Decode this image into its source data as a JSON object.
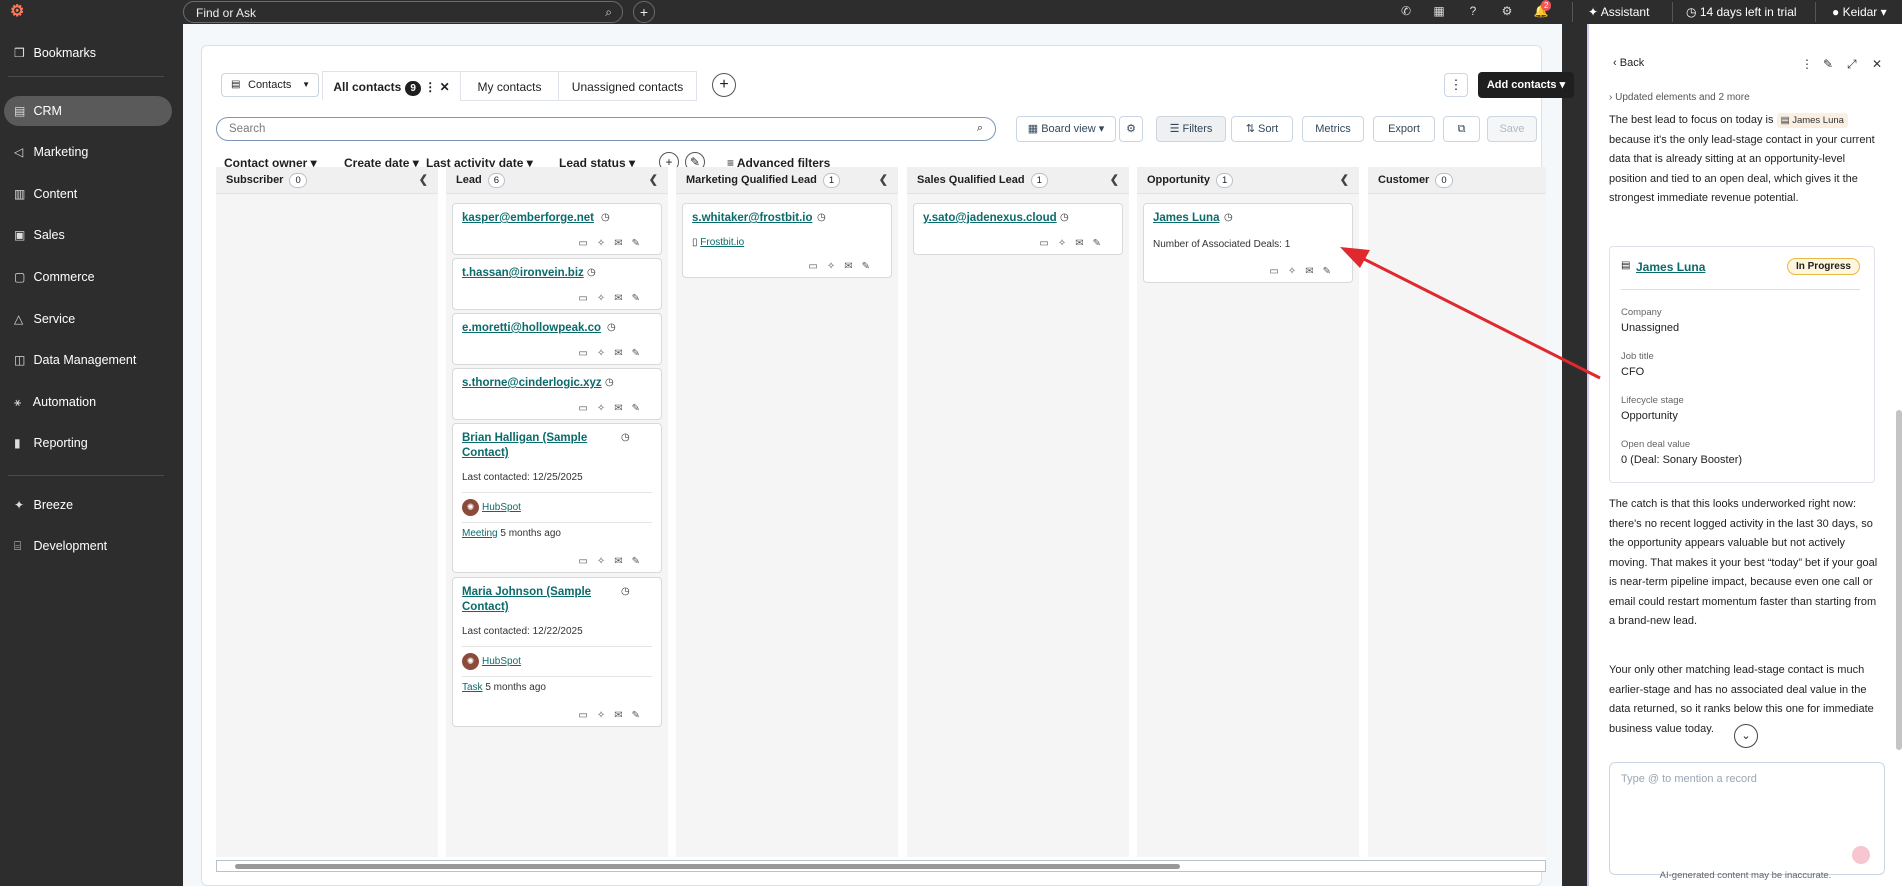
{
  "topbar": {
    "search_placeholder": "Find or Ask",
    "assistant_label": "Assistant",
    "trial_label": "14 days left in trial",
    "user_name": "Keidar",
    "notification_count": "2"
  },
  "sidebar": {
    "items": [
      {
        "label": "Bookmarks",
        "icon": "bookmark-icon"
      },
      {
        "label": "CRM",
        "icon": "crm-icon"
      },
      {
        "label": "Marketing",
        "icon": "megaphone-icon"
      },
      {
        "label": "Content",
        "icon": "content-icon"
      },
      {
        "label": "Sales",
        "icon": "sales-icon"
      },
      {
        "label": "Commerce",
        "icon": "commerce-icon"
      },
      {
        "label": "Service",
        "icon": "service-icon"
      },
      {
        "label": "Data Management",
        "icon": "database-icon"
      },
      {
        "label": "Automation",
        "icon": "automation-icon"
      },
      {
        "label": "Reporting",
        "icon": "chart-icon"
      },
      {
        "label": "Breeze",
        "icon": "sparkle-icon"
      },
      {
        "label": "Development",
        "icon": "code-icon"
      }
    ]
  },
  "header": {
    "object_selector": "Contacts",
    "tabs": [
      {
        "label": "All contacts",
        "count": "9"
      },
      {
        "label": "My contacts"
      },
      {
        "label": "Unassigned contacts"
      }
    ],
    "add_contacts_label": "Add contacts"
  },
  "toolbar": {
    "search_placeholder": "Search",
    "view_label": "Board view",
    "filters_label": "Filters",
    "sort_label": "Sort",
    "metrics_label": "Metrics",
    "export_label": "Export",
    "save_label": "Save"
  },
  "filters": {
    "items": [
      "Contact owner",
      "Create date",
      "Last activity date",
      "Lead status"
    ],
    "advanced_label": "Advanced filters"
  },
  "board": {
    "columns": [
      {
        "name": "Subscriber",
        "count": "0"
      },
      {
        "name": "Lead",
        "count": "6"
      },
      {
        "name": "Marketing Qualified Lead",
        "count": "1"
      },
      {
        "name": "Sales Qualified Lead",
        "count": "1"
      },
      {
        "name": "Opportunity",
        "count": "1"
      },
      {
        "name": "Customer",
        "count": "0"
      }
    ],
    "lead_cards": [
      {
        "title": "kasper@emberforge.net"
      },
      {
        "title": "t.hassan@ironvein.biz"
      },
      {
        "title": "e.moretti@hollowpeak.co"
      },
      {
        "title": "s.thorne@cinderlogic.xyz"
      },
      {
        "title": "Brian Halligan (Sample Contact)",
        "last_contacted": "Last contacted: 12/25/2025",
        "company": "HubSpot",
        "activity_type": "Meeting",
        "activity_time": "5 months ago"
      },
      {
        "title": "Maria Johnson (Sample Contact)",
        "last_contacted": "Last contacted: 12/22/2025",
        "company": "HubSpot",
        "activity_type": "Task",
        "activity_time": "5 months ago"
      }
    ],
    "mql_card": {
      "title": "s.whitaker@frostbit.io",
      "company": "Frostbit.io"
    },
    "sql_card": {
      "title": "y.sato@jadenexus.cloud"
    },
    "opp_card": {
      "title": "James Luna",
      "deals": "Number of Associated Deals: 1"
    }
  },
  "panel": {
    "back_label": "Back",
    "updated": "Updated elements and 2 more",
    "para1_pre": "The best lead to focus on today is",
    "para1_chip": "James Luna",
    "para1_post": "because it's the only lead-stage contact in your current data that is already sitting at an opportunity-level position and tied to an open deal, which gives it the strongest immediate revenue potential.",
    "card": {
      "name": "James Luna",
      "status": "In Progress",
      "company_label": "Company",
      "company": "Unassigned",
      "job_label": "Job title",
      "job": "CFO",
      "stage_label": "Lifecycle stage",
      "stage": "Opportunity",
      "deal_label": "Open deal value",
      "deal": "0 (Deal: Sonary Booster)"
    },
    "para2": "The catch is that this looks underworked right now: there's no recent logged activity in the last 30 days, so the opportunity appears valuable but not actively moving. That makes it your best “today” bet if your goal is near-term pipeline impact, because even one call or email could restart momentum faster than starting from a brand-new lead.",
    "para3": "Your only other matching lead-stage contact is much earlier-stage and has no associated deal value in the data returned, so it ranks below this one for immediate business value today.",
    "composer_placeholder": "Type @ to mention a record",
    "disclaimer": "AI-generated content may be inaccurate."
  },
  "colors": {
    "accent": "#0b6b6b",
    "arrow": "#e0282e",
    "dark": "#2d2d2d"
  }
}
